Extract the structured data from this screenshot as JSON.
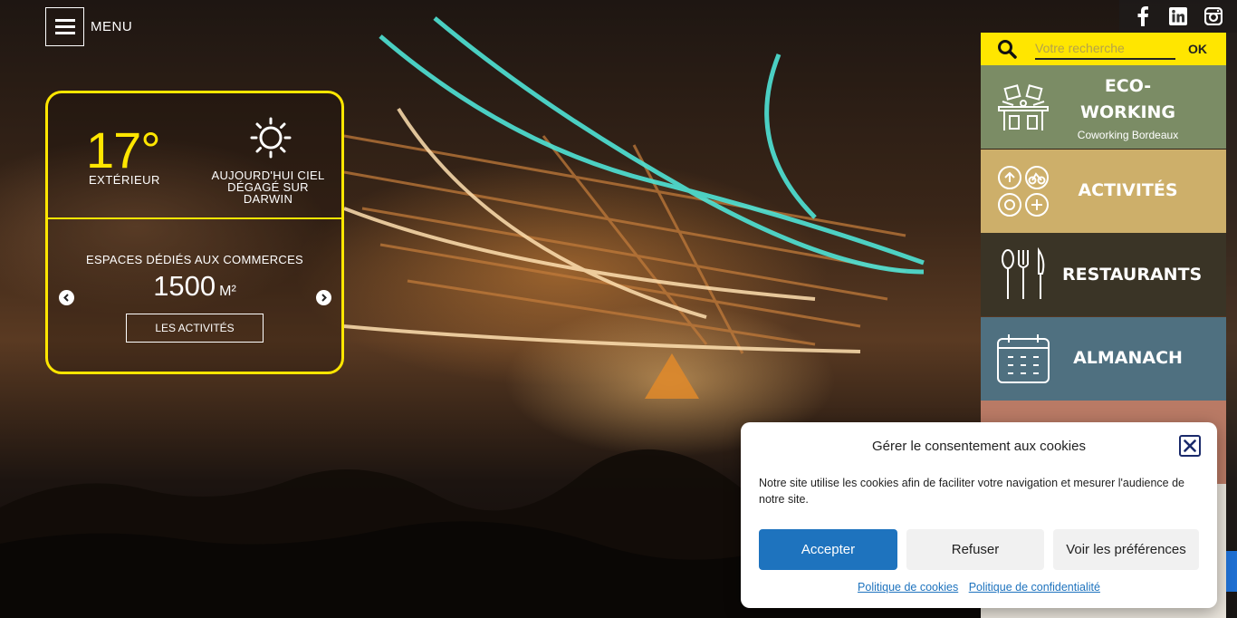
{
  "menu": {
    "label": "MENU"
  },
  "weather": {
    "temperature": "17°",
    "temperature_label": "EXTÉRIEUR",
    "icon": "sun-icon",
    "description": "AUJOURD'HUI CIEL DÉGAGÉ SUR DARWIN"
  },
  "slider": {
    "label": "ESPACES DÉDIÉS AUX COMMERCES",
    "value": "1500",
    "unit": "M²",
    "button_label": "LES ACTIVITÉS"
  },
  "social": {
    "icons": [
      "facebook-icon",
      "linkedin-icon",
      "instagram-icon"
    ]
  },
  "search": {
    "placeholder": "Votre recherche",
    "value": "",
    "ok_label": "OK"
  },
  "tiles": [
    {
      "title": "ECO-WORKING",
      "subtitle": "Coworking Bordeaux",
      "icon": "coworking-icon",
      "color": "#7b8c65"
    },
    {
      "title": "ACTIVITÉS",
      "subtitle": "",
      "icon": "activities-icon",
      "color": "#cdaf6a"
    },
    {
      "title": "RESTAURANTS",
      "subtitle": "",
      "icon": "cutlery-icon",
      "color": "#3a3426"
    },
    {
      "title": "ALMANACH",
      "subtitle": "",
      "icon": "calendar-icon",
      "color": "#4f7080"
    }
  ],
  "cookie": {
    "title": "Gérer le consentement aux cookies",
    "text": "Notre site utilise les cookies afin de faciliter votre navigation et mesurer l'audience de notre site.",
    "accept_label": "Accepter",
    "refuse_label": "Refuser",
    "preferences_label": "Voir les préférences",
    "cookie_policy_label": "Politique de cookies",
    "privacy_policy_label": "Politique de confidentialité"
  },
  "colors": {
    "accent_yellow": "#ffe600",
    "accept_blue": "#1e73be"
  }
}
